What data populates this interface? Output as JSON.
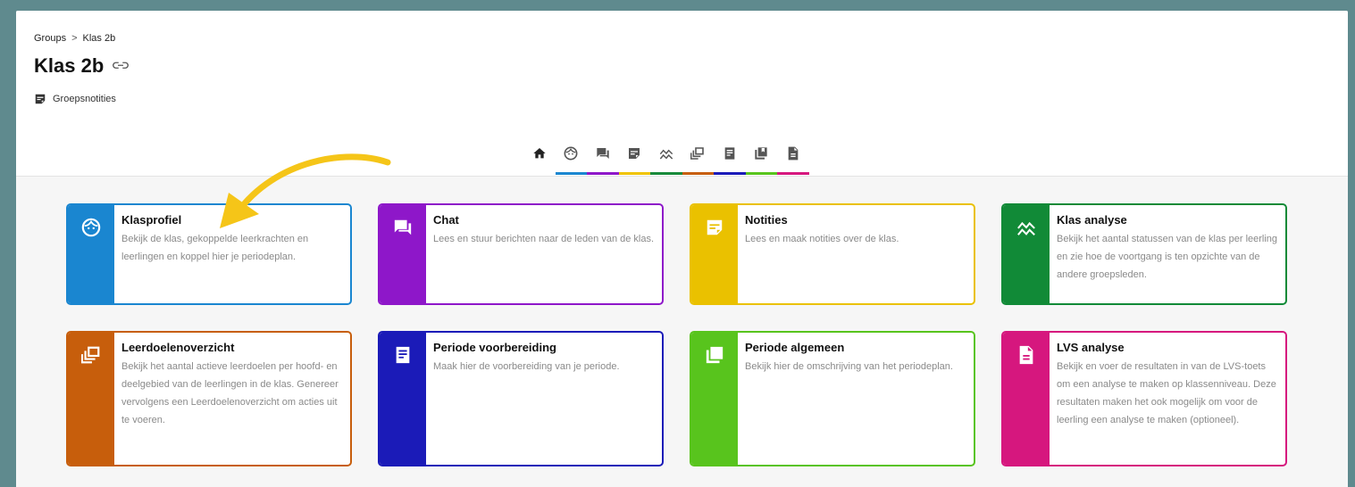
{
  "breadcrumb": {
    "root": "Groups",
    "separator": ">",
    "current": "Klas 2b"
  },
  "page_title": "Klas 2b",
  "notes_link": "Groepsnotities",
  "tabs": [
    {
      "icon": "home-icon",
      "color": "#1a86d0"
    },
    {
      "icon": "face-icon",
      "color": "#1a86d0"
    },
    {
      "icon": "chat-icon",
      "color": "#8e17c9"
    },
    {
      "icon": "note-icon",
      "color": "#f0c300"
    },
    {
      "icon": "chart-icon",
      "color": "#188a3a"
    },
    {
      "icon": "goals-icon",
      "color": "#c75e0c"
    },
    {
      "icon": "calendar-icon",
      "color": "#1b1bb8"
    },
    {
      "icon": "book-icon",
      "color": "#58c41d"
    },
    {
      "icon": "document-icon",
      "color": "#d6177e"
    }
  ],
  "cards": [
    {
      "title": "Klasprofiel",
      "description": "Bekijk de klas, gekoppelde leerkrachten en leerlingen en koppel hier je periodeplan.",
      "color": "#1a86d0",
      "icon": "face-icon"
    },
    {
      "title": "Chat",
      "description": "Lees en stuur berichten naar de leden van de klas.",
      "color": "#8e17c9",
      "icon": "chat-icon"
    },
    {
      "title": "Notities",
      "description": "Lees en maak notities over de klas.",
      "color": "#eac100",
      "icon": "note-icon"
    },
    {
      "title": "Klas analyse",
      "description": "Bekijk het aantal statussen van de klas per leerling en zie hoe de voortgang is ten opzichte van de andere groepsleden.",
      "color": "#118a37",
      "icon": "chart-icon"
    },
    {
      "title": "Leerdoelenoverzicht",
      "description": "Bekijk het aantal actieve leerdoelen per hoofd- en deelgebied van de leerlingen in de klas. Genereer vervolgens een Leerdoelenoverzicht om acties uit te voeren.",
      "color": "#c75e0c",
      "icon": "goals-icon"
    },
    {
      "title": "Periode voorbereiding",
      "description": "Maak hier de voorbereiding van je periode.",
      "color": "#1b1bb8",
      "icon": "calendar-icon"
    },
    {
      "title": "Periode algemeen",
      "description": "Bekijk hier de omschrijving van het periodeplan.",
      "color": "#58c41d",
      "icon": "book-icon"
    },
    {
      "title": "LVS analyse",
      "description": "Bekijk en voer de resultaten in van de LVS-toets om een analyse te maken op klassenniveau. Deze resultaten maken het ook mogelijk om voor de leerling een analyse te maken (optioneel).",
      "color": "#d6177e",
      "icon": "document-icon"
    }
  ],
  "annotation_arrow_color": "#f5c518"
}
